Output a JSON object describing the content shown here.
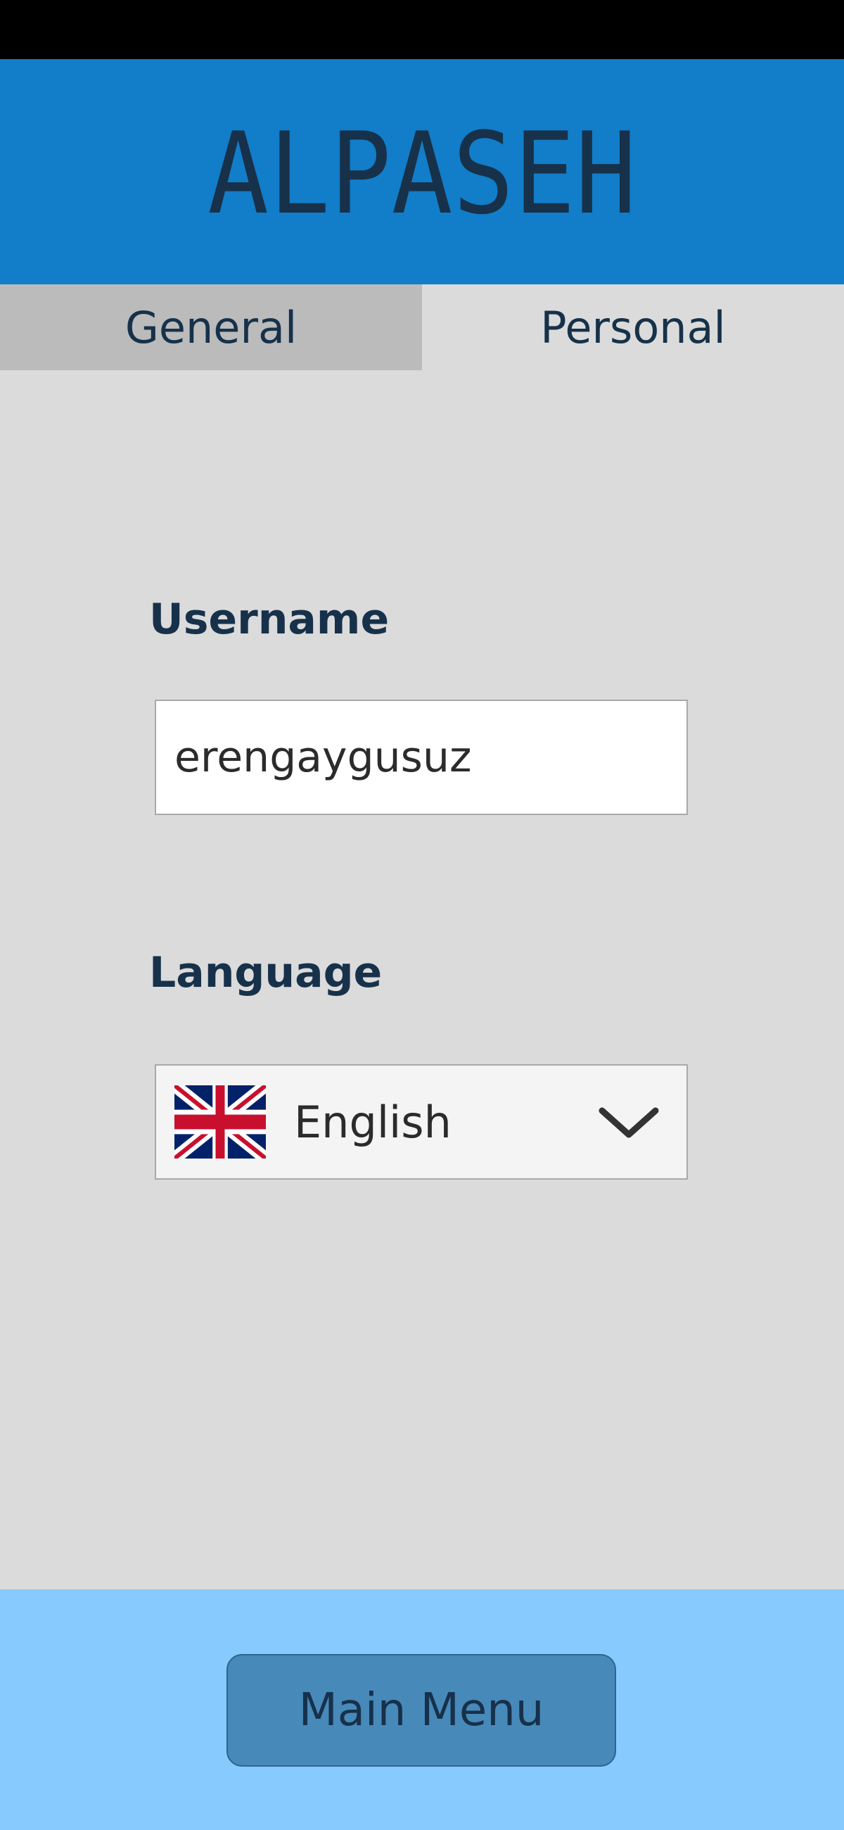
{
  "app": {
    "title": "ALPASEH"
  },
  "tabs": [
    {
      "label": "General",
      "selected": false
    },
    {
      "label": "Personal",
      "selected": true
    }
  ],
  "personal": {
    "username_label": "Username",
    "username_value": "erengaygusuz",
    "language_label": "Language",
    "language_value": "English",
    "language_flag_icon": "uk-flag-icon"
  },
  "footer": {
    "main_menu_label": "Main Menu"
  },
  "colors": {
    "header": "#127dc8",
    "logo": "#17314a",
    "footer": "#87cafd",
    "button": "#4789b9"
  }
}
